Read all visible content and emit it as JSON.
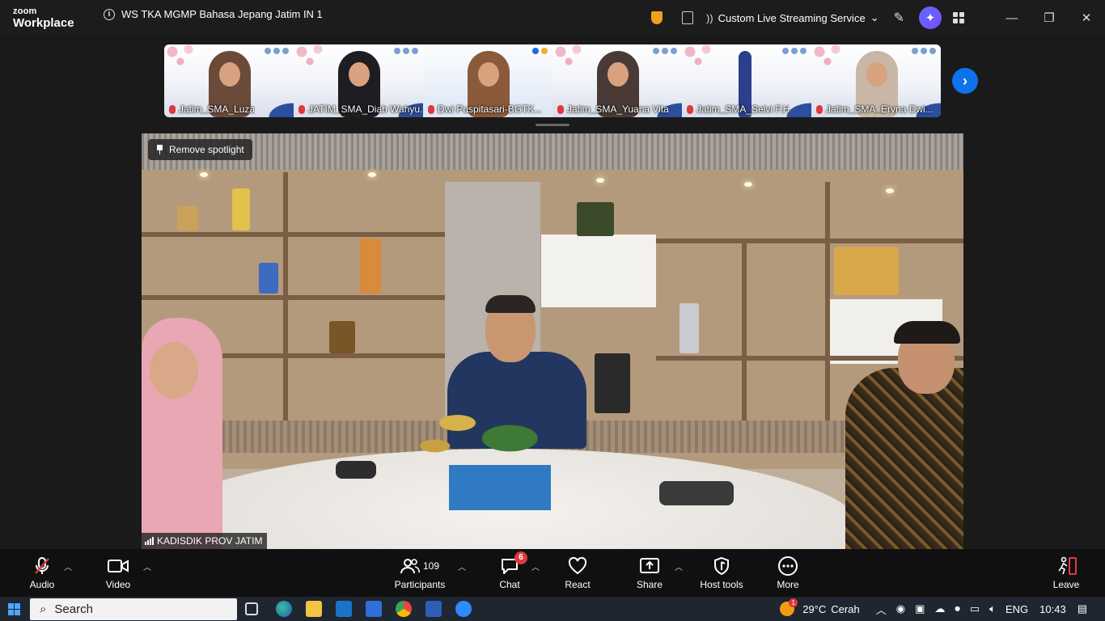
{
  "app": {
    "logo_line1": "zoom",
    "logo_line2": "Workplace"
  },
  "meeting": {
    "title": "WS TKA MGMP Bahasa Jepang Jatim IN 1"
  },
  "titlebar": {
    "streaming_label": "Custom Live Streaming Service",
    "icons": [
      "security-shield-icon",
      "notes-icon",
      "streaming-icon",
      "whiteboard-pen-icon",
      "ai-companion-icon",
      "apps-icon"
    ],
    "window_controls": {
      "minimize": "—",
      "restore": "❐",
      "close": "✕"
    }
  },
  "gallery": {
    "participants": [
      {
        "name": "Jatim_SMA_Luza"
      },
      {
        "name": "JATIM_SMA_Diah Wahyu..."
      },
      {
        "name": "Dwi Puspitasari-BGTK..."
      },
      {
        "name": "Jatim_SMA_Yuana Vita"
      },
      {
        "name": "Jatim_SMA_Selvi F.H"
      },
      {
        "name": "Jatim_SMA_Eryna Dwi..."
      }
    ],
    "next_label": "›"
  },
  "spotlight": {
    "remove_label": "Remove spotlight",
    "speaker_name": "KADISDIK PROV JATIM"
  },
  "toolbar": {
    "audio": "Audio",
    "video": "Video",
    "participants": "Participants",
    "participants_count": "109",
    "chat": "Chat",
    "chat_badge": "6",
    "react": "React",
    "share": "Share",
    "host_tools": "Host tools",
    "more": "More",
    "leave": "Leave"
  },
  "taskbar": {
    "search_placeholder": "Search",
    "weather_temp": "29°C",
    "weather_text": "Cerah",
    "weather_badge": "1",
    "language": "ENG",
    "time": "10:43",
    "apps": [
      "task-view-icon",
      "edge-icon",
      "file-explorer-icon",
      "outlook-icon",
      "store-icon",
      "chrome-icon",
      "word-icon",
      "zoom-icon"
    ]
  },
  "colors": {
    "accent": "#0e72ed",
    "muted_red": "#e0393e",
    "ai": "#6a5cff"
  }
}
